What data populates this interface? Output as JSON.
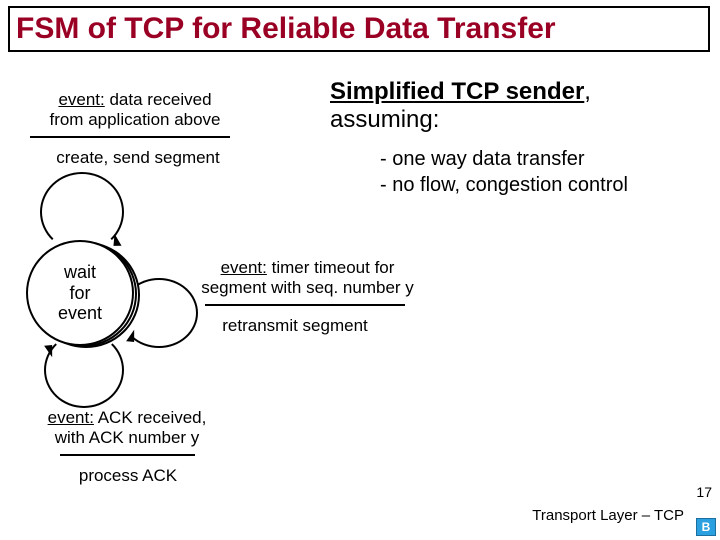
{
  "title": "FSM of TCP for Reliable Data Transfer",
  "right": {
    "heading_lead": "Simplified TCP sender",
    "heading_tail": ", assuming:",
    "bullet1": "- one way data transfer",
    "bullet2": "- no flow, congestion control"
  },
  "state": {
    "label_line1": "wait",
    "label_line2": "for",
    "label_line3": "event"
  },
  "event1": {
    "kw": "event:",
    "text_line1": " data received",
    "text_line2": "from application above",
    "action": "create, send segment"
  },
  "event2": {
    "kw": "event:",
    "text_line1": " timer timeout for",
    "text_line2": "segment with seq. number y",
    "action": "retransmit segment"
  },
  "event3": {
    "kw": "event:",
    "text_line1": " ACK received,",
    "text_line2": "with ACK number y",
    "action": "process ACK"
  },
  "footer": {
    "text": "Transport Layer – TCP",
    "page": "17",
    "badge": "B"
  }
}
